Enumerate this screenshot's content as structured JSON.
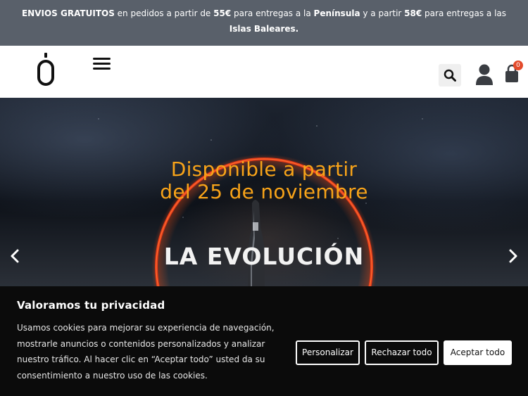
{
  "announcement": {
    "parts": [
      {
        "text": "ENVIOS GRATUITOS",
        "bold": true
      },
      {
        "text": " en pedidos a partir de ",
        "bold": false
      },
      {
        "text": "55€",
        "bold": true
      },
      {
        "text": " para entregas a la ",
        "bold": false
      },
      {
        "text": "Península",
        "bold": true
      },
      {
        "text": " y a partir ",
        "bold": false
      },
      {
        "text": "58€",
        "bold": true
      },
      {
        "text": " para entregas a las ",
        "bold": false
      },
      {
        "text": "Islas Baleares.",
        "bold": true
      }
    ]
  },
  "header": {
    "logo_icon": "brand-o-logo-icon",
    "menu_icon": "hamburger-menu-icon",
    "search_icon": "search-icon",
    "account_icon": "user-icon",
    "cart_icon": "shopping-bag-icon",
    "cart_count": "0"
  },
  "hero": {
    "title_line1": "Disponible a partir",
    "title_line2": "del 25 de noviembre",
    "headline": "LA EVOLUCIÓN",
    "prev_icon": "chevron-left-icon",
    "next_icon": "chevron-right-icon",
    "accent_color": "#f7a319",
    "ring_color": "#e83a1a"
  },
  "cookie_banner": {
    "title": "Valoramos tu privacidad",
    "text": "Usamos cookies para mejorar su experiencia de navegación, mostrarle anuncios o contenidos personalizados y analizar nuestro tráfico. Al hacer clic en “Aceptar todo” usted da su consentimiento a nuestro uso de las cookies.",
    "buttons": {
      "personalize": "Personalizar",
      "reject": "Rechazar todo",
      "accept": "Aceptar todo"
    }
  },
  "colors": {
    "topbar_bg": "#59606a",
    "cookie_bg": "#0b0b0b",
    "badge": "#e34b2c"
  }
}
